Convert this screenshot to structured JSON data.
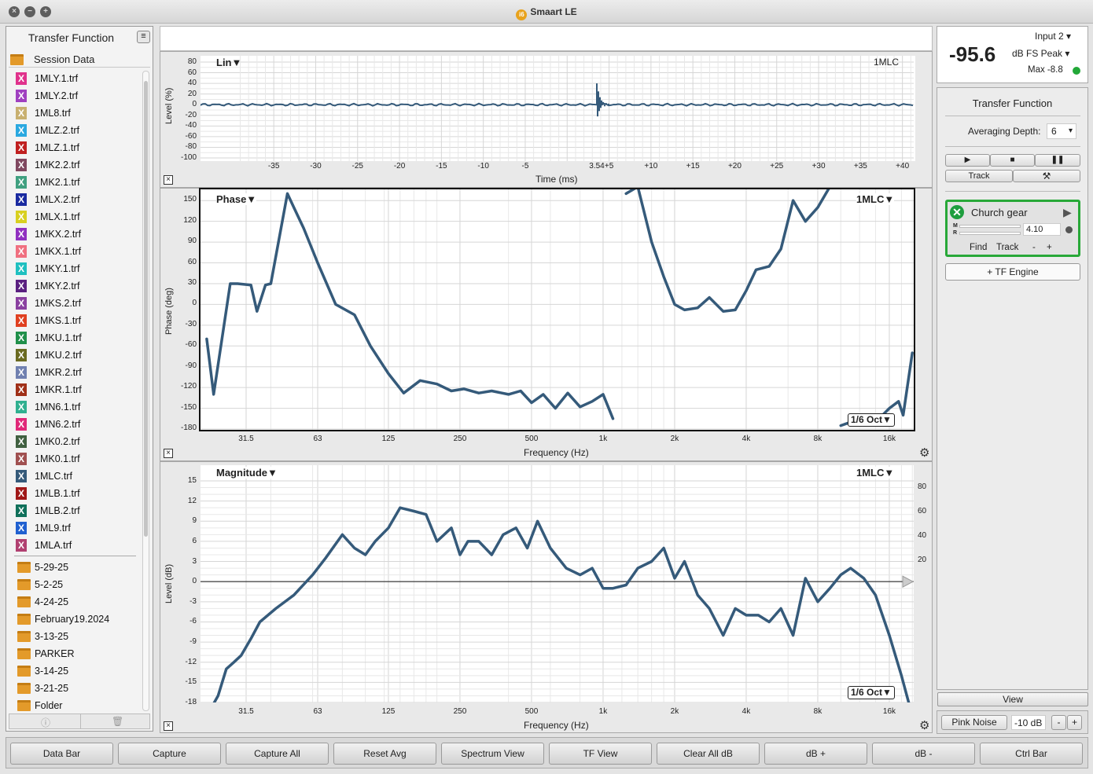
{
  "window": {
    "title": "Smaart LE"
  },
  "sidebar": {
    "title": "Transfer Function",
    "session_label": "Session Data",
    "files": [
      {
        "name": "1MLY.1.trf",
        "color": "#e0328c"
      },
      {
        "name": "1MLY.2.trf",
        "color": "#a040c0"
      },
      {
        "name": "1ML8.trf",
        "color": "#c8b070"
      },
      {
        "name": "1MLZ.2.trf",
        "color": "#2aa8e0"
      },
      {
        "name": "1MLZ.1.trf",
        "color": "#c02020"
      },
      {
        "name": "1MK2.2.trf",
        "color": "#804860"
      },
      {
        "name": "1MK2.1.trf",
        "color": "#40a080"
      },
      {
        "name": "1MLX.2.trf",
        "color": "#1a2aa0"
      },
      {
        "name": "1MLX.1.trf",
        "color": "#d8d020"
      },
      {
        "name": "1MKX.2.trf",
        "color": "#9030c0"
      },
      {
        "name": "1MKX.1.trf",
        "color": "#f07080"
      },
      {
        "name": "1MKY.1.trf",
        "color": "#20c0c0"
      },
      {
        "name": "1MKY.2.trf",
        "color": "#5a2080"
      },
      {
        "name": "1MKS.2.trf",
        "color": "#8a40a0"
      },
      {
        "name": "1MKS.1.trf",
        "color": "#e04020"
      },
      {
        "name": "1MKU.1.trf",
        "color": "#20904a"
      },
      {
        "name": "1MKU.2.trf",
        "color": "#6a6a20"
      },
      {
        "name": "1MKR.2.trf",
        "color": "#7080b0"
      },
      {
        "name": "1MKR.1.trf",
        "color": "#a03018"
      },
      {
        "name": "1MN6.1.trf",
        "color": "#30b090"
      },
      {
        "name": "1MN6.2.trf",
        "color": "#e02878"
      },
      {
        "name": "1MK0.2.trf",
        "color": "#406040"
      },
      {
        "name": "1MK0.1.trf",
        "color": "#a05050"
      },
      {
        "name": "1MLC.trf",
        "color": "#355a7a"
      },
      {
        "name": "1MLB.1.trf",
        "color": "#a01818"
      },
      {
        "name": "1MLB.2.trf",
        "color": "#10705a"
      },
      {
        "name": "1ML9.trf",
        "color": "#2060d0"
      },
      {
        "name": "1MLA.trf",
        "color": "#b04070"
      }
    ],
    "folders": [
      "5-29-25",
      "5-2-25",
      "4-24-25",
      "February19.2024",
      "3-13-25",
      "PARKER",
      "3-14-25",
      "3-21-25",
      "Folder"
    ]
  },
  "impulse": {
    "title": "Lin▼",
    "trace": "1MLC",
    "y_label": "Level (%)",
    "x_label": "Time (ms)",
    "y_ticks": [
      "80",
      "60",
      "40",
      "20",
      "0",
      "-20",
      "-40",
      "-60",
      "-80",
      "-100"
    ],
    "x_ticks": [
      "-35",
      "-30",
      "-25",
      "-20",
      "-15",
      "-10",
      "-5",
      "3.54",
      "+5",
      "+10",
      "+15",
      "+20",
      "+25",
      "+30",
      "+35",
      "+40"
    ]
  },
  "phase": {
    "title": "Phase▼",
    "trace": "1MLC▼",
    "y_label": "Phase (deg)",
    "x_label": "Frequency (Hz)",
    "y_ticks": [
      "150",
      "120",
      "90",
      "60",
      "30",
      "0",
      "-30",
      "-60",
      "-90",
      "-120",
      "-150",
      "-180"
    ],
    "x_ticks": [
      "31.5",
      "63",
      "125",
      "250",
      "500",
      "1k",
      "2k",
      "4k",
      "8k",
      "16k"
    ],
    "smoothing": "1/6 Oct▼"
  },
  "magnitude": {
    "title": "Magnitude▼",
    "trace": "1MLC▼",
    "y_label": "Level (dB)",
    "x_label": "Frequency (Hz)",
    "y_ticks": [
      "15",
      "12",
      "9",
      "6",
      "3",
      "0",
      "-3",
      "-6",
      "-9",
      "-12",
      "-15",
      "-18"
    ],
    "y2_ticks": [
      "80",
      "60",
      "40",
      "20"
    ],
    "x_ticks": [
      "31.5",
      "63",
      "125",
      "250",
      "500",
      "1k",
      "2k",
      "4k",
      "8k",
      "16k"
    ],
    "smoothing": "1/6 Oct▼"
  },
  "meter": {
    "value": "-95.6",
    "input": "Input 2",
    "mode": "dB FS Peak",
    "max": "Max -8.8",
    "status_color": "#22a838"
  },
  "right_panel": {
    "title": "Transfer Function",
    "averaging_label": "Averaging Depth:",
    "averaging_value": "6",
    "track_label": "Track",
    "engine": {
      "name": "Church gear",
      "m": "M",
      "r": "R",
      "value": "4.10",
      "find": "Find",
      "track": "Track",
      "minus": "-",
      "plus": "+"
    },
    "add_engine": "+ TF Engine",
    "view": "View",
    "pink_noise": "Pink Noise",
    "noise_level": "-10 dB",
    "minus": "-",
    "plus": "+"
  },
  "toolbar": [
    "Data Bar",
    "Capture",
    "Capture All",
    "Reset Avg",
    "Spectrum View",
    "TF View",
    "Clear All dB",
    "dB +",
    "dB -",
    "Ctrl Bar"
  ],
  "chart_data": [
    {
      "type": "line",
      "title": "Lin",
      "xlabel": "Time (ms)",
      "ylabel": "Level (%)",
      "ylim": [
        -100,
        80
      ],
      "xlim": [
        -40,
        45
      ],
      "series": [
        {
          "name": "1MLC",
          "x": [
            -40,
            3.3,
            3.54,
            3.8,
            4.5,
            6,
            45
          ],
          "y": [
            0,
            0,
            40,
            -20,
            5,
            0,
            0
          ]
        }
      ]
    },
    {
      "type": "line",
      "title": "Phase",
      "xlabel": "Frequency (Hz)",
      "ylabel": "Phase (deg)",
      "ylim": [
        -180,
        165
      ],
      "log_x": true,
      "series": [
        {
          "name": "1MLC",
          "x": [
            21.5,
            23,
            27,
            29,
            33,
            35,
            38,
            40,
            47,
            50,
            55,
            63,
            75,
            90,
            105,
            125,
            145,
            170,
            200,
            230,
            260,
            300,
            340,
            400,
            450,
            500,
            560,
            630,
            710,
            800,
            900,
            1000,
            1100,
            1250,
            1400,
            1600,
            1800,
            2000,
            2200,
            2500,
            2800,
            3200,
            3600,
            4000,
            4400,
            5000,
            5600,
            6300,
            7100,
            8000,
            9000,
            10000,
            11000,
            12500,
            14000,
            16000,
            17500,
            18300,
            20000
          ],
          "y": [
            -50,
            -130,
            30,
            30,
            28,
            -10,
            28,
            30,
            160,
            140,
            110,
            60,
            0,
            -15,
            -60,
            -100,
            -128,
            -110,
            -115,
            -125,
            -122,
            -128,
            -125,
            -130,
            -125,
            -142,
            -130,
            -150,
            -128,
            -148,
            -140,
            -130,
            -165,
            -200,
            170,
            90,
            40,
            0,
            -8,
            -5,
            10,
            -10,
            -8,
            20,
            50,
            55,
            80,
            150,
            120,
            140,
            170,
            185,
            190,
            190,
            190,
            -150,
            -140,
            -160,
            -70
          ]
        }
      ],
      "smoothing": "1/6 Oct"
    },
    {
      "type": "line",
      "title": "Magnitude",
      "xlabel": "Frequency (Hz)",
      "ylabel": "Level (dB)",
      "ylim": [
        -18,
        15
      ],
      "log_x": true,
      "series": [
        {
          "name": "1MLC",
          "x": [
            21.5,
            24,
            26,
            28,
            30,
            33,
            36,
            42,
            50,
            60,
            68,
            80,
            90,
            100,
            110,
            125,
            140,
            160,
            180,
            200,
            230,
            250,
            270,
            300,
            340,
            380,
            430,
            480,
            530,
            600,
            700,
            800,
            900,
            1000,
            1100,
            1250,
            1400,
            1600,
            1800,
            2000,
            2200,
            2500,
            2800,
            3200,
            3600,
            4000,
            4500,
            5000,
            5600,
            6300,
            7100,
            8000,
            9000,
            10000,
            11000,
            12500,
            14000,
            16000,
            18000,
            20000
          ],
          "y": [
            -20,
            -17,
            -13,
            -12,
            -11,
            -8.5,
            -6,
            -4,
            -2,
            1,
            3.5,
            7,
            5,
            4,
            6,
            8,
            11,
            10.5,
            10,
            6,
            8,
            4,
            6,
            6,
            4,
            7,
            8,
            5,
            9,
            5,
            2,
            1,
            2,
            -1,
            -1,
            -0.5,
            2,
            3,
            5,
            0.5,
            3,
            -2,
            -4,
            -8,
            -4,
            -5,
            -5,
            -6,
            -4,
            -8,
            0.5,
            -3,
            -1,
            1,
            2,
            0.5,
            -2,
            -8,
            -14,
            -20
          ]
        }
      ],
      "smoothing": "1/6 Oct"
    }
  ]
}
